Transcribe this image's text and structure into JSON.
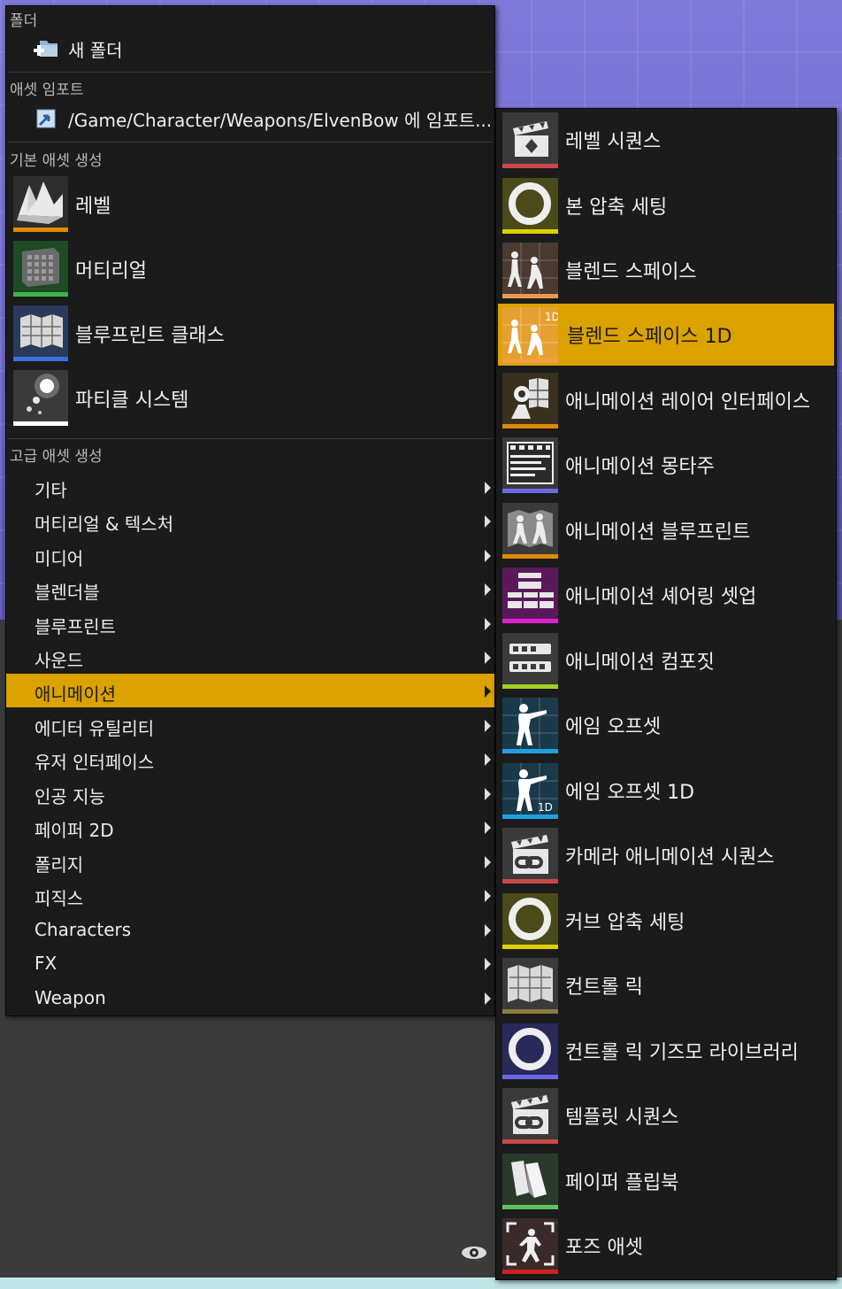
{
  "folder_section": {
    "header": "폴더",
    "new_folder": "새 폴더"
  },
  "import_section": {
    "header": "애셋 임포트",
    "import_item": "/Game/Character/Weapons/ElvenBow 에 임포트..."
  },
  "basic_section": {
    "header": "기본 애셋 생성",
    "items": [
      {
        "label": "레벨",
        "icon": "level-icon",
        "color": "#e08a00"
      },
      {
        "label": "머티리얼",
        "icon": "material-icon",
        "color": "#3cb44a"
      },
      {
        "label": "블루프린트 클래스",
        "icon": "blueprint-icon",
        "color": "#3a6fe0"
      },
      {
        "label": "파티클 시스템",
        "icon": "particle-icon",
        "color": "#ffffff"
      }
    ]
  },
  "advanced_section": {
    "header": "고급 애셋 생성",
    "items": [
      {
        "label": "기타"
      },
      {
        "label": "머티리얼 & 텍스처"
      },
      {
        "label": "미디어"
      },
      {
        "label": "블렌더블"
      },
      {
        "label": "블루프린트"
      },
      {
        "label": "사운드"
      },
      {
        "label": "애니메이션",
        "active": true
      },
      {
        "label": "에디터 유틸리티"
      },
      {
        "label": "유저 인터페이스"
      },
      {
        "label": "인공 지능"
      },
      {
        "label": "페이퍼 2D"
      },
      {
        "label": "폴리지"
      },
      {
        "label": "피직스"
      },
      {
        "label": "Characters"
      },
      {
        "label": "FX"
      },
      {
        "label": "Weapon"
      }
    ]
  },
  "animation_submenu": {
    "items": [
      {
        "label": "레벨 시퀀스",
        "icon": "clapper-icon",
        "color": "#c84848"
      },
      {
        "label": "본 압축 세팅",
        "icon": "ring-icon",
        "color": "#e0d000"
      },
      {
        "label": "블렌드 스페이스",
        "icon": "blendspace-icon",
        "color": "#e89a50"
      },
      {
        "label": "블렌드 스페이스 1D",
        "icon": "blendspace-1d-icon",
        "color": "#f0a040",
        "active": true,
        "badge": "1D"
      },
      {
        "label": "애니메이션 레이어 인터페이스",
        "icon": "anim-layer-interface-icon",
        "color": "#e08a00"
      },
      {
        "label": "애니메이션 몽타주",
        "icon": "montage-icon",
        "color": "#6a6ae8"
      },
      {
        "label": "애니메이션 블루프린트",
        "icon": "anim-blueprint-icon",
        "color": "#e08a00"
      },
      {
        "label": "애니메이션 셰어링 셋업",
        "icon": "sharing-setup-icon",
        "color": "#e020d0"
      },
      {
        "label": "애니메이션 컴포짓",
        "icon": "composite-icon",
        "color": "#a0d020"
      },
      {
        "label": "에임 오프셋",
        "icon": "aim-offset-icon",
        "color": "#20a0e0"
      },
      {
        "label": "에임 오프셋 1D",
        "icon": "aim-offset-1d-icon",
        "color": "#20a0e0",
        "badge": "1D"
      },
      {
        "label": "카메라 애니메이션 시퀀스",
        "icon": "camera-sequence-icon",
        "color": "#c84848"
      },
      {
        "label": "커브 압축 세팅",
        "icon": "ring-icon",
        "color": "#e0d000"
      },
      {
        "label": "컨트롤 릭",
        "icon": "control-rig-icon",
        "color": "#8a7a40"
      },
      {
        "label": "컨트롤 릭 기즈모 라이브러리",
        "icon": "ring-icon",
        "color": "#6a6ae8"
      },
      {
        "label": "템플릿 시퀀스",
        "icon": "template-sequence-icon",
        "color": "#c84848"
      },
      {
        "label": "페이퍼 플립북",
        "icon": "flipbook-icon",
        "color": "#60c060"
      },
      {
        "label": "포즈 애셋",
        "icon": "pose-asset-icon",
        "color": "#d02020"
      }
    ]
  }
}
